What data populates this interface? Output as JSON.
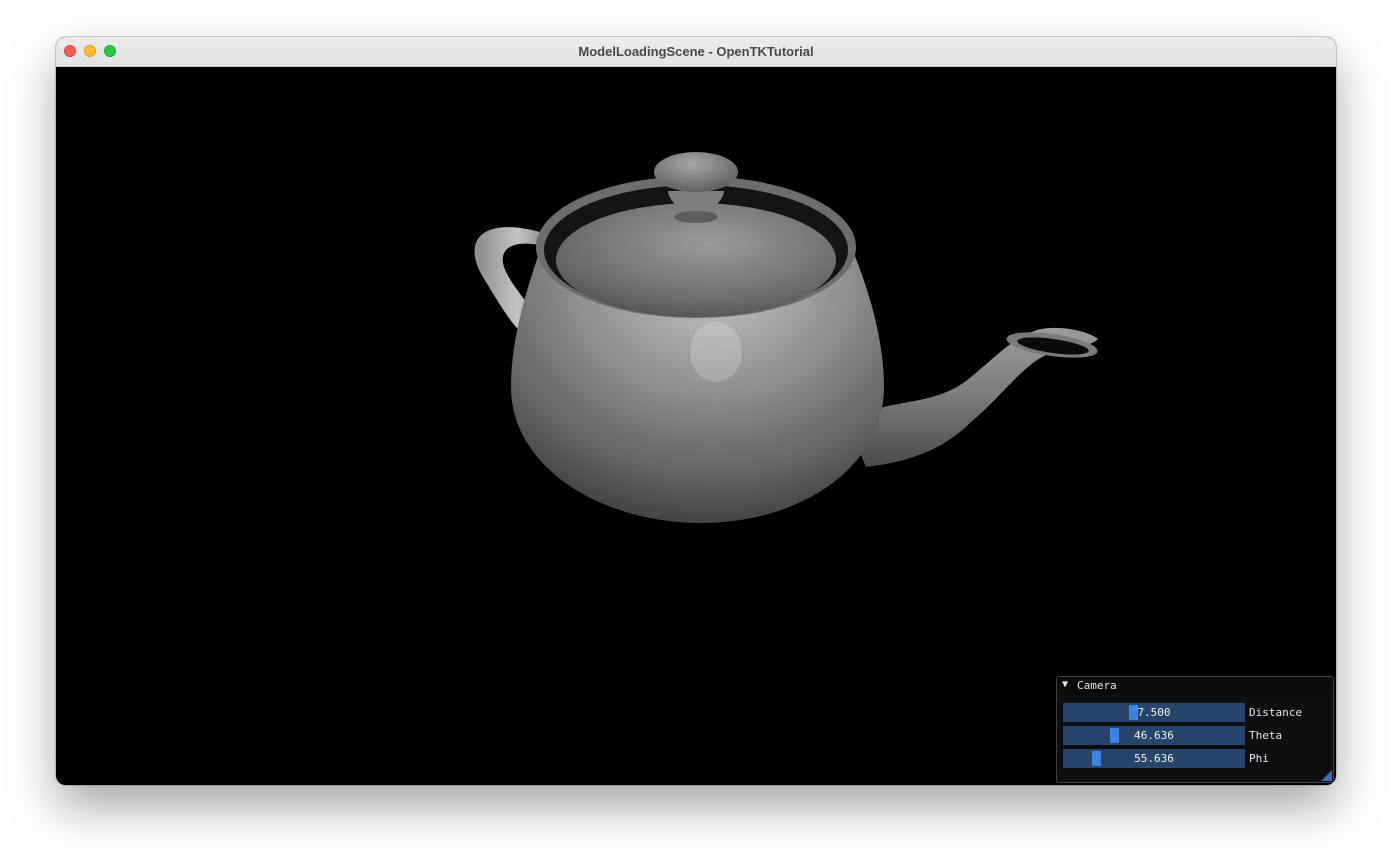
{
  "window": {
    "title": "ModelLoadingScene - OpenTKTutorial"
  },
  "camera_panel": {
    "title": "Camera",
    "collapse_icon": "triangle-down-icon",
    "sliders": [
      {
        "label": "Distance",
        "value": "7.500",
        "fraction": 0.38
      },
      {
        "label": "Theta",
        "value": "46.636",
        "fraction": 0.27
      },
      {
        "label": "Phi",
        "value": "55.636",
        "fraction": 0.17
      }
    ]
  },
  "colors": {
    "viewport_background": "#000000",
    "slider_track": "#29446b",
    "slider_grab": "#3d85e0",
    "panel_background": "#0f0f11"
  }
}
